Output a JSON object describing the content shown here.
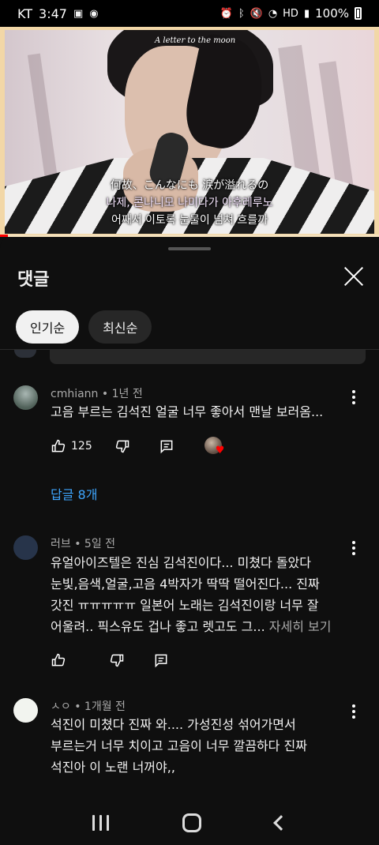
{
  "status_bar": {
    "carrier": "KT",
    "time": "3:47",
    "battery": "100%",
    "icons_left": [
      "image-icon",
      "talk-icon"
    ],
    "icons_right": [
      "alarm-icon",
      "bluetooth-icon",
      "mute-icon",
      "wifi-icon",
      "hd-icon",
      "signal-icon",
      "battery-icon"
    ]
  },
  "video": {
    "overlay_title": "A letter to the moon",
    "subtitle_jp": "何故、こんなにも 涙が溢れるの",
    "subtitle_romaji": "나제, 콘나니모 나미다가 아후레루노",
    "subtitle_kr": "어째서 이토록 눈물이 넘쳐 흐를까",
    "progress": 0.02,
    "progress_color": "#ff0000"
  },
  "sheet": {
    "title": "댓글",
    "close_icon": "close-icon",
    "chips": [
      "인기순",
      "최신순"
    ],
    "active_chip": 0
  },
  "comments": [
    {
      "author": "cmhiann",
      "age": "1년 전",
      "meta": "cmhiann • 1년 전",
      "text": "고음 부르는 김석진 얼굴 너무 좋아서 맨날 보러옴...",
      "likes": "125",
      "replies_label": "답글 8개",
      "creator_heart": true
    },
    {
      "author": "러브",
      "age": "5일 전",
      "meta": "러브 • 5일 전",
      "text_lines": [
        "유얼아이즈텔은 진심 김석진이다... 미쳤다 돌았다",
        "눈빛,음색,얼굴,고음 4박자가 딱딱 떨어진다... 진짜",
        "갓진 ㅠㅠㅠㅠㅠ  일본어 노래는 김석진이랑 너무 잘",
        "어울려.. 픽스유도 겁나 좋고 렛고도 그..."
      ],
      "more_label": "자세히 보기"
    },
    {
      "author": "ㅅㅇ",
      "age": "1개월 전",
      "meta": "ㅅㅇ • 1개월 전",
      "text_lines": [
        "석진이 미쳤다 진짜 와.... 가성진성 섞어가면서",
        "부르는거 너무 치이고 고음이 너무 깔끔하다 진짜",
        "석진아 이 노랜 너꺼야,,"
      ]
    }
  ],
  "navbar": {
    "icons": [
      "recents-icon",
      "home-icon",
      "back-icon"
    ]
  }
}
